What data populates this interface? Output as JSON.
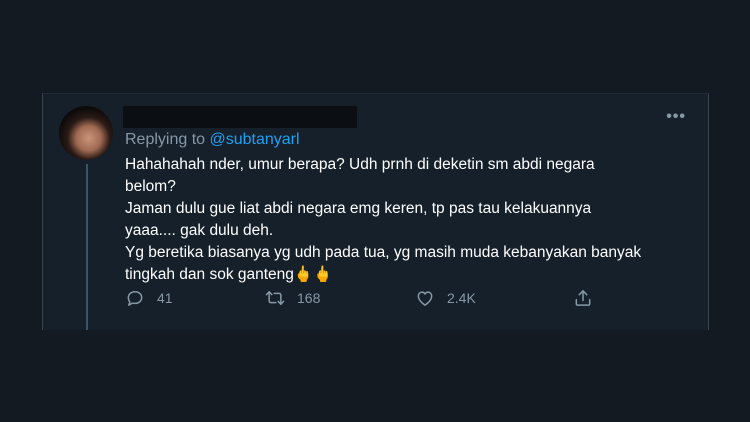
{
  "tweet": {
    "replying_prefix": "Replying to ",
    "replying_handle": "@subtanyarl",
    "lines": [
      "Hahahahah nder, umur berapa? Udh prnh di deketin sm abdi negara",
      "belom?",
      "Jaman dulu gue liat abdi negara emg keren, tp pas tau kelakuannya",
      "yaaa.... gak dulu deh.",
      "Yg beretika biasanya yg udh pada tua, yg masih muda kebanyakan banyak",
      "tingkah dan sok ganteng🖕🖕"
    ],
    "more_label": "•••"
  },
  "actions": {
    "reply_count": "41",
    "retweet_count": "168",
    "like_count": "2.4K",
    "reply_icon": "reply-icon",
    "retweet_icon": "retweet-icon",
    "like_icon": "heart-icon",
    "share_icon": "share-icon"
  },
  "colors": {
    "background": "#15202b",
    "text": "#ffffff",
    "muted": "#8899a6",
    "link": "#1da1f2"
  }
}
